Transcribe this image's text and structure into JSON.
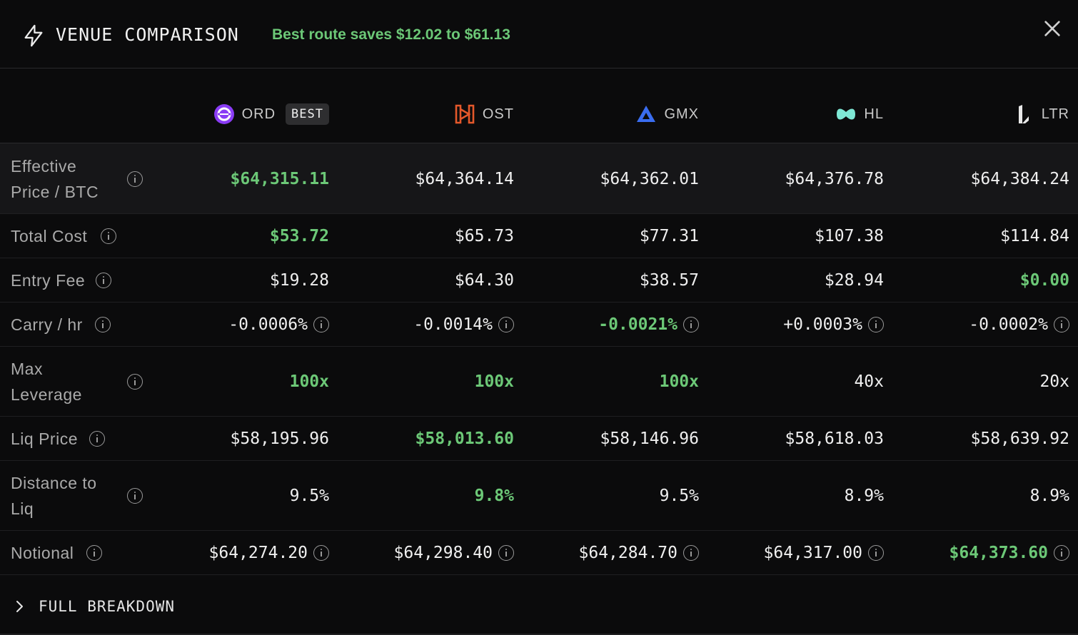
{
  "header": {
    "title": "VENUE COMPARISON",
    "savings": "Best route saves $12.02 to $61.13",
    "icon": "lightning-bolt-icon",
    "close_icon": "close-icon"
  },
  "colors": {
    "background": "#0b0b0c",
    "good": "#6cc877",
    "highlight_row": "#161618",
    "text": "#efefef",
    "label": "#aaaaaa"
  },
  "venues": [
    {
      "name": "ORD",
      "badge": "BEST",
      "icon": "ord-logo-icon",
      "color": "#8a3cf5"
    },
    {
      "name": "OST",
      "icon": "ost-logo-icon",
      "color": "#e4582b"
    },
    {
      "name": "GMX",
      "icon": "gmx-logo-icon",
      "color": "#3a6df0"
    },
    {
      "name": "HL",
      "icon": "hl-logo-icon",
      "color": "#7ee8d5"
    },
    {
      "name": "LTR",
      "icon": "ltr-logo-icon",
      "color": "#e8e8e8"
    }
  ],
  "rows": [
    {
      "label_lines": [
        "Effective",
        "Price / BTC"
      ],
      "values": [
        "$64,315.11",
        "$64,364.14",
        "$64,362.01",
        "$64,376.78",
        "$64,384.24"
      ],
      "good": [
        0
      ]
    },
    {
      "label_lines": [
        "Total Cost"
      ],
      "values": [
        "$53.72",
        "$65.73",
        "$77.31",
        "$107.38",
        "$114.84"
      ],
      "good": [
        0
      ]
    },
    {
      "label_lines": [
        "Entry Fee"
      ],
      "values": [
        "$19.28",
        "$64.30",
        "$38.57",
        "$28.94",
        "$0.00"
      ],
      "good": [
        4
      ]
    },
    {
      "label_lines": [
        "Carry / hr"
      ],
      "values": [
        "-0.0006%",
        "-0.0014%",
        "-0.0021%",
        "+0.0003%",
        "-0.0002%"
      ],
      "good": [
        2
      ]
    },
    {
      "label_lines": [
        "Max",
        "Leverage"
      ],
      "values": [
        "100x",
        "100x",
        "100x",
        "40x",
        "20x"
      ],
      "good": [
        0,
        1,
        2
      ]
    },
    {
      "label_lines": [
        "Liq Price"
      ],
      "values": [
        "$58,195.96",
        "$58,013.60",
        "$58,146.96",
        "$58,618.03",
        "$58,639.92"
      ],
      "good": [
        1
      ]
    },
    {
      "label_lines": [
        "Distance to",
        "Liq"
      ],
      "values": [
        "9.5%",
        "9.8%",
        "9.5%",
        "8.9%",
        "8.9%"
      ],
      "good": [
        1
      ]
    },
    {
      "label_lines": [
        "Notional"
      ],
      "values": [
        "$64,274.20",
        "$64,298.40",
        "$64,284.70",
        "$64,317.00",
        "$64,373.60"
      ],
      "good": [
        4
      ]
    }
  ],
  "footer": {
    "label": "FULL BREAKDOWN",
    "icon": "chevron-right-icon"
  }
}
